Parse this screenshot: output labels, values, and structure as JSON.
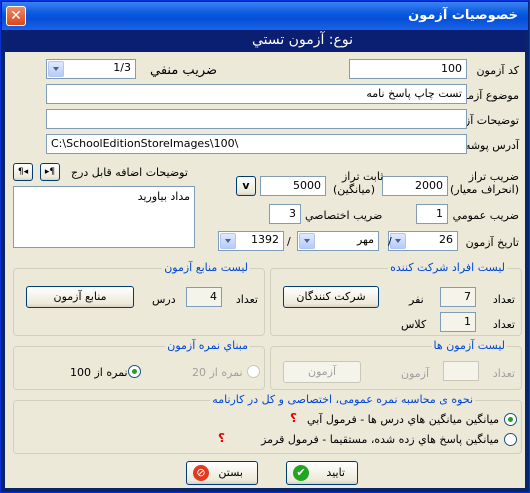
{
  "window": {
    "title": "خصوصيات آزمون",
    "close_glyph": "✕"
  },
  "header": {
    "text": "نوع: آزمون تستي"
  },
  "form": {
    "code_label": "کد آزمون",
    "code_value": "100",
    "negative_label": "ضريب منفي",
    "negative_value": "1/3",
    "subject_label": "موضوع آزمون",
    "subject_value": "تست چاپ پاسخ نامه",
    "desc_label": "توضيحات آزمون",
    "desc_value": "",
    "folder_label": "آدرس پوشه",
    "folder_value": "C:\\SchoolEditionStoreImages\\100\\",
    "extra_label": "توضيحات اضافه قابل درج",
    "extra_btn1": "¶◂",
    "extra_btn2": "▸¶",
    "extra_text": "مداد بياوريد",
    "balance_coef_label": "ضريب تراز",
    "balance_coef_sub": "(انحراف معيار)",
    "balance_coef_value": "2000",
    "balance_const_label": "ثابت تراز",
    "balance_const_sub": "(ميانگين)",
    "balance_const_value": "5000",
    "v_button": "v",
    "general_coef_label": "ضريب عمومي",
    "general_coef_value": "1",
    "special_coef_label": "ضريب اختصاصي",
    "special_coef_value": "3",
    "date_label": "تاريخ آزمون",
    "date_day": "26",
    "date_month": "مهر",
    "date_year": "1392",
    "date_sep": "/"
  },
  "participants": {
    "title": "ليست افراد شرکت کننده",
    "count_label": "تعداد",
    "person_count": "7",
    "person_unit": "نفر",
    "class_count": "1",
    "class_unit": "کلاس",
    "button": "شرکت کنندگان"
  },
  "sources": {
    "title": "ليست منابع آزمون",
    "count_label": "تعداد",
    "lesson_count": "4",
    "lesson_unit": "درس",
    "button": "منابع آزمون"
  },
  "tests": {
    "title": "ليست آزمون ها",
    "count_label": "تعداد",
    "count_value": "",
    "unit": "آزمون",
    "button": "آزمون"
  },
  "score_base": {
    "title": "مبناي نمره آزمون",
    "option20": "نمره از 20",
    "option100": "نمره از 100"
  },
  "calc": {
    "title": "نحوه ی محاسبه نمره عمومی، اختصاصی و کل در کارنامه",
    "option1": "ميانگين ميانگين هاي درس ها - فرمول آبي",
    "option2": "ميانگين پاسخ هاي زده شده، مستقيما - فرمول قرمز",
    "q": "؟"
  },
  "actions": {
    "ok": "تاييد",
    "close": "بستن"
  },
  "colors": {
    "title_blue": "#0550d8",
    "header_navy": "#0a1e72",
    "group_title": "#0046d5",
    "question": "#e00000"
  }
}
